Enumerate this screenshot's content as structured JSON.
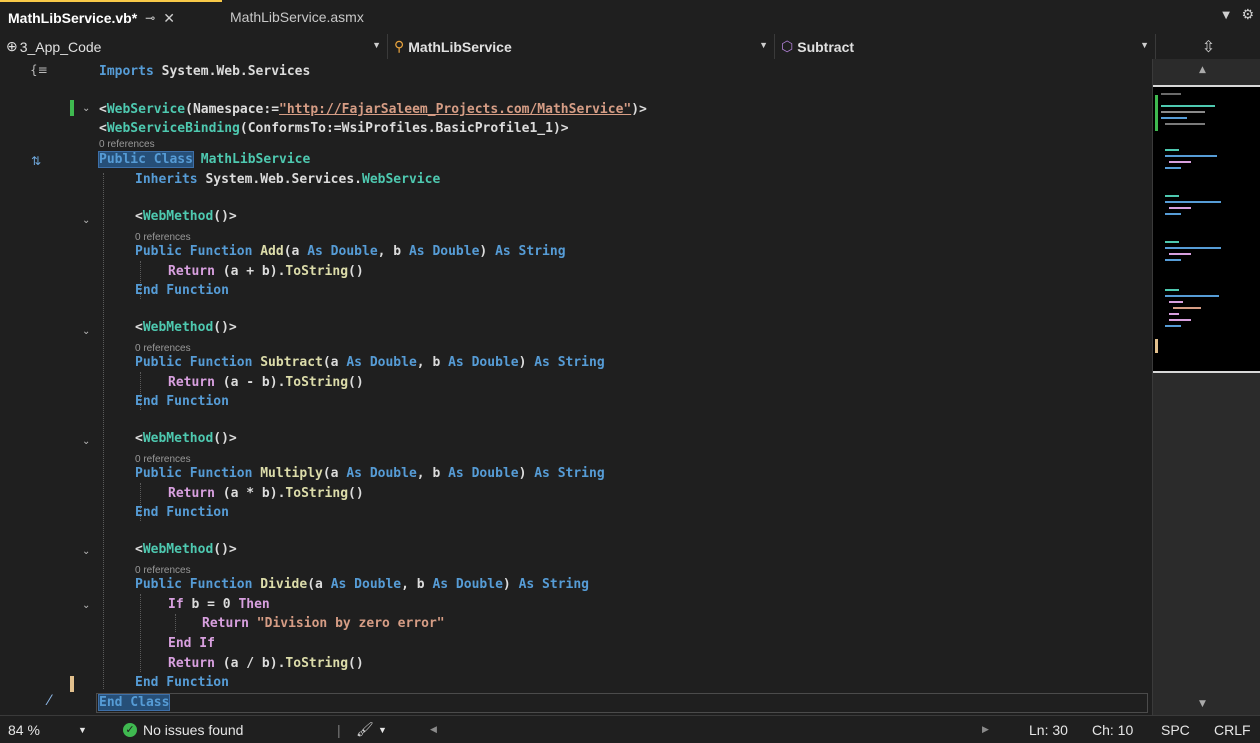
{
  "tabs": {
    "active": {
      "label": "MathLibService.vb*"
    },
    "inactive": {
      "label": "MathLibService.asmx"
    }
  },
  "navbar": {
    "project": "3_App_Code",
    "class": "MathLibService",
    "member": "Subtract"
  },
  "codelens": "0 references",
  "code": {
    "imports": "Imports",
    "imports_ns": "System.Web.Services",
    "ws_attr": "WebService",
    "ws_ns_param": "Namespace:=",
    "ws_url": "\"http://FajarSaleem_Projects.com/MathService\"",
    "wsb_attr": "WebServiceBinding",
    "wsb_param": "ConformsTo:=",
    "wsb_value": "WsiProfiles.BasicProfile1_1",
    "public_class": "Public Class",
    "class_name": "MathLibService",
    "inherits": "Inherits",
    "inherits_base": "System.Web.Services.WebService",
    "webmethod": "WebMethod",
    "public_function": "Public Function",
    "as_double": "As Double",
    "as_string": "As String",
    "ret": "Return",
    "tostring": "ToString",
    "end_function": "End Function",
    "fn_add": "Add",
    "fn_subtract": "Subtract",
    "fn_multiply": "Multiply",
    "fn_divide": "Divide",
    "expr_add": "(a + b).",
    "expr_sub": "(a - b).",
    "expr_mul": "(a * b).",
    "expr_div": "(a / b).",
    "if_kw": "If",
    "if_cond": "b = 0",
    "then_kw": "Then",
    "err_string": "\"Division by zero error\"",
    "end_if": "End If",
    "end_class": "End Class"
  },
  "status": {
    "zoom": "84 %",
    "issues": "No issues found",
    "line": "Ln: 30",
    "col": "Ch: 10",
    "spaces": "SPC",
    "eol": "CRLF"
  },
  "colors": {
    "keyword": "#569cd6",
    "control": "#d8a0df",
    "type": "#4ec9b0",
    "string": "#d69d85",
    "method": "#dcdcaa",
    "ok": "#3fb950"
  }
}
